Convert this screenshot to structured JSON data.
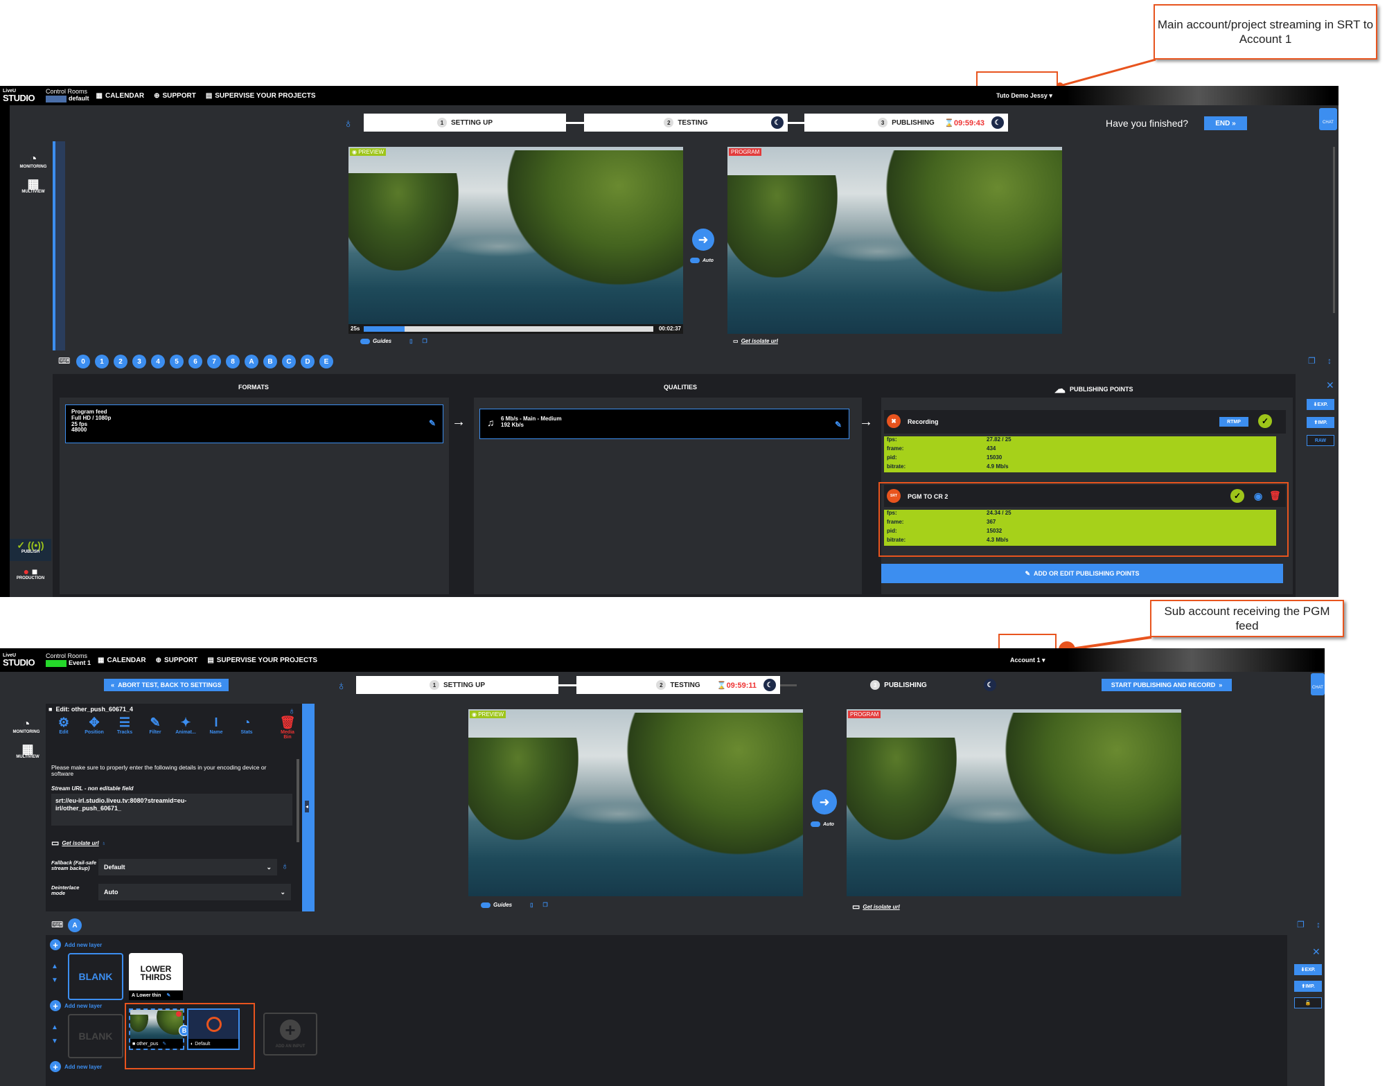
{
  "callouts": {
    "top": "Main account/project streaming in SRT to Account 1",
    "bottom": "Sub account receiving the PGM feed"
  },
  "top": {
    "logo": {
      "line1": "LiveU",
      "line2": "STUDIO"
    },
    "control_rooms": "Control Rooms",
    "event": "default",
    "nav": {
      "calendar": "CALENDAR",
      "support": "SUPPORT",
      "supervise": "SUPERVISE YOUR PROJECTS"
    },
    "account": "Tuto Demo Jessy",
    "steps": [
      {
        "num": "1",
        "label": "SETTING UP"
      },
      {
        "num": "2",
        "label": "TESTING"
      },
      {
        "num": "3",
        "label": "PUBLISHING"
      }
    ],
    "timer": "09:59:43",
    "finished_question": "Have you finished?",
    "end_button": "END",
    "chat": "CHAT",
    "side": {
      "monitoring": "MONITORING",
      "multiview": "MULTIVIEW",
      "publish": "PUBLISH",
      "production": "PRODUCTION"
    },
    "preview_tag": "PREVIEW",
    "program_tag": "PROGRAM",
    "preview_start": "25s",
    "preview_end": "00:02:37",
    "preview_progress": 0.14,
    "auto": "Auto",
    "guides": "Guides",
    "isolate": "Get isolate url",
    "number_buttons": [
      "0",
      "1",
      "2",
      "3",
      "4",
      "5",
      "6",
      "7",
      "8",
      "A",
      "B",
      "C",
      "D",
      "E"
    ],
    "formats_header": "FORMATS",
    "qualities_header": "QUALITIES",
    "pp_header": "PUBLISHING POINTS",
    "format": {
      "l1": "Program feed",
      "l2": "Full HD / 1080p",
      "l3": "25 fps",
      "l4": "48000"
    },
    "quality": {
      "l1": "6 Mb/s  -  Main  -  Medium",
      "l2": "192 Kb/s"
    },
    "recording": {
      "name": "Recording",
      "protocol": "RTMP",
      "stats": [
        {
          "k": "fps:",
          "v": "27.82 / 25"
        },
        {
          "k": "frame:",
          "v": "434"
        },
        {
          "k": "pid:",
          "v": "15030"
        },
        {
          "k": "bitrate:",
          "v": "4.9 Mb/s"
        }
      ]
    },
    "pgm": {
      "name": "PGM TO CR 2",
      "icon_text": "SRT",
      "stats": [
        {
          "k": "fps:",
          "v": "24.34 / 25"
        },
        {
          "k": "frame:",
          "v": "367"
        },
        {
          "k": "pid:",
          "v": "15032"
        },
        {
          "k": "bitrate:",
          "v": "4.3 Mb/s"
        }
      ]
    },
    "add_pp": "ADD OR EDIT PUBLISHING POINTS",
    "exp": "EXP.",
    "imp": "IMP.",
    "raw": "RAW"
  },
  "bottom": {
    "logo": {
      "line1": "LiveU",
      "line2": "STUDIO"
    },
    "control_rooms": "Control Rooms",
    "event": "Event 1",
    "nav": {
      "calendar": "CALENDAR",
      "support": "SUPPORT",
      "supervise": "SUPERVISE YOUR PROJECTS"
    },
    "account": "Account 1",
    "abort": "ABORT TEST, BACK TO SETTINGS",
    "steps": [
      {
        "num": "1",
        "label": "SETTING UP"
      },
      {
        "num": "2",
        "label": "TESTING"
      },
      {
        "num": "3",
        "label": "PUBLISHING"
      }
    ],
    "timer": "09:59:11",
    "start_button": "START PUBLISHING AND RECORD",
    "chat": "CHAT",
    "side": {
      "monitoring": "MONITORING",
      "multiview": "MULTIVIEW"
    },
    "edit_title": "Edit: other_push_60671_4",
    "tools": [
      "Edit",
      "Position",
      "Tracks",
      "Filter",
      "Animat...",
      "Name",
      "Stats"
    ],
    "media_bin": "Media Bin",
    "instructions": "Please make sure to properly enter the following details in your encoding device or software",
    "stream_url_label": "Stream URL - non editable field",
    "stream_url": "srt://eu-irl.studio.liveu.tv:8080?streamid=eu-irl/other_push_60671_",
    "isolate": "Get isolate url",
    "fallback_label": "Fallback (Fail-safe stream backup)",
    "fallback_value": "Default",
    "deinterlace_label": "Deinterlace mode",
    "deinterlace_value": "Auto",
    "preview_tag": "PREVIEW",
    "program_tag": "PROGRAM",
    "auto": "Auto",
    "guides": "Guides",
    "number_buttons": [
      "A"
    ],
    "add_layer": "Add new layer",
    "blank": "BLANK",
    "lower_thirds": "LOWER THIRDS",
    "lower_thin": "Lower thin",
    "other_push": "other_pus",
    "default_label": "Default",
    "add_input": "ADD AN INPUT",
    "exp": "EXP.",
    "imp": "IMP."
  }
}
